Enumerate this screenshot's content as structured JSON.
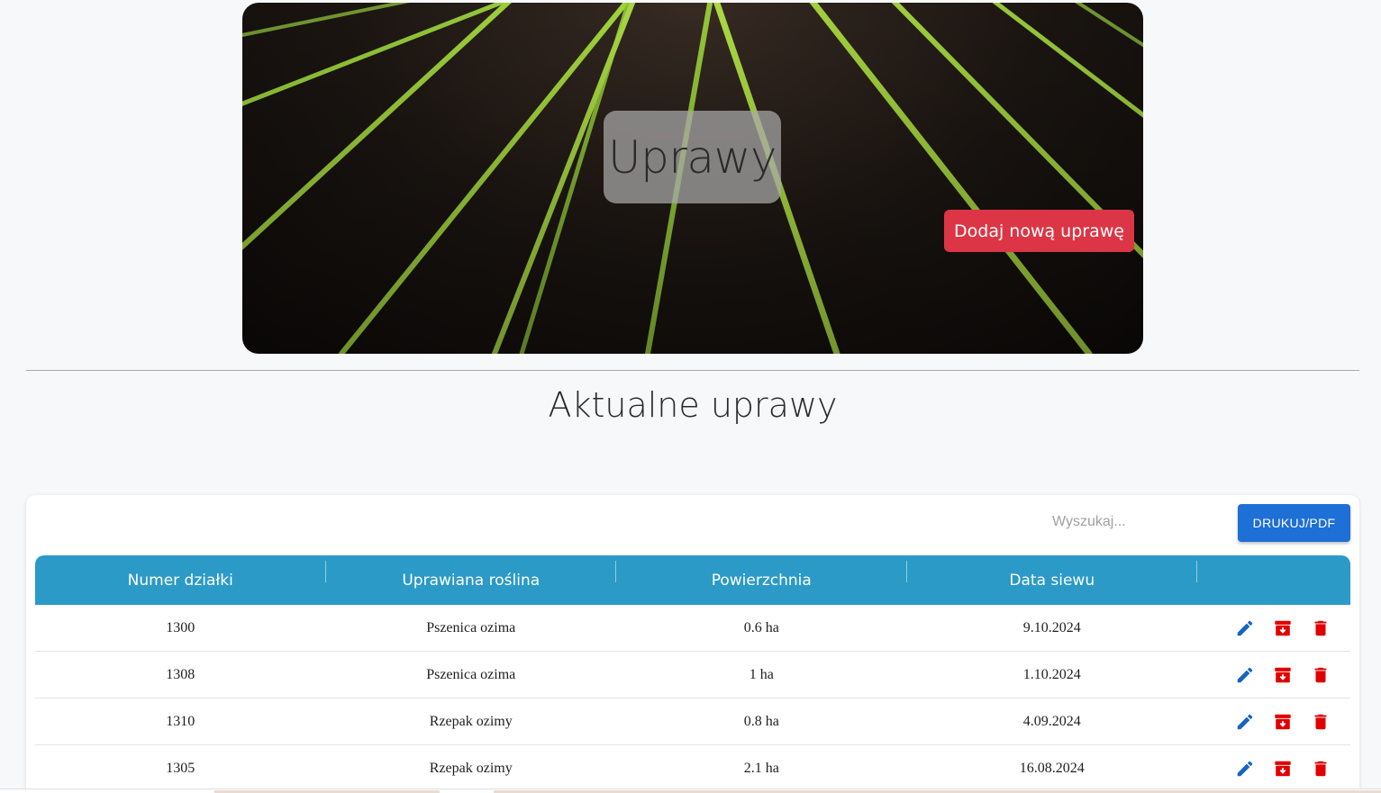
{
  "hero": {
    "title": "Uprawy",
    "add_button_label": "Dodaj nową uprawę"
  },
  "section": {
    "title": "Aktualne uprawy"
  },
  "toolbar": {
    "search_placeholder": "Wyszukaj...",
    "print_label": "DRUKUJ/PDF"
  },
  "table": {
    "columns": [
      "Numer działki",
      "Uprawiana roślina",
      "Powierzchnia",
      "Data siewu"
    ],
    "rows": [
      {
        "plot": "1300",
        "crop": "Pszenica ozima",
        "area": "0.6 ha",
        "date": "9.10.2024"
      },
      {
        "plot": "1308",
        "crop": "Pszenica ozima",
        "area": "1 ha",
        "date": "1.10.2024"
      },
      {
        "plot": "1310",
        "crop": "Rzepak ozimy",
        "area": "0.8 ha",
        "date": "4.09.2024"
      },
      {
        "plot": "1305",
        "crop": "Rzepak ozimy",
        "area": "2.1 ha",
        "date": "16.08.2024"
      }
    ],
    "row_action_icons": [
      "pencil-icon",
      "archive-icon",
      "trash-icon"
    ]
  },
  "colors": {
    "accent_red": "#dc3545",
    "table_header": "#2b9ac6",
    "print_button": "#1e6fd6",
    "edit_icon": "#1565c0",
    "danger_icon": "#e00000"
  }
}
